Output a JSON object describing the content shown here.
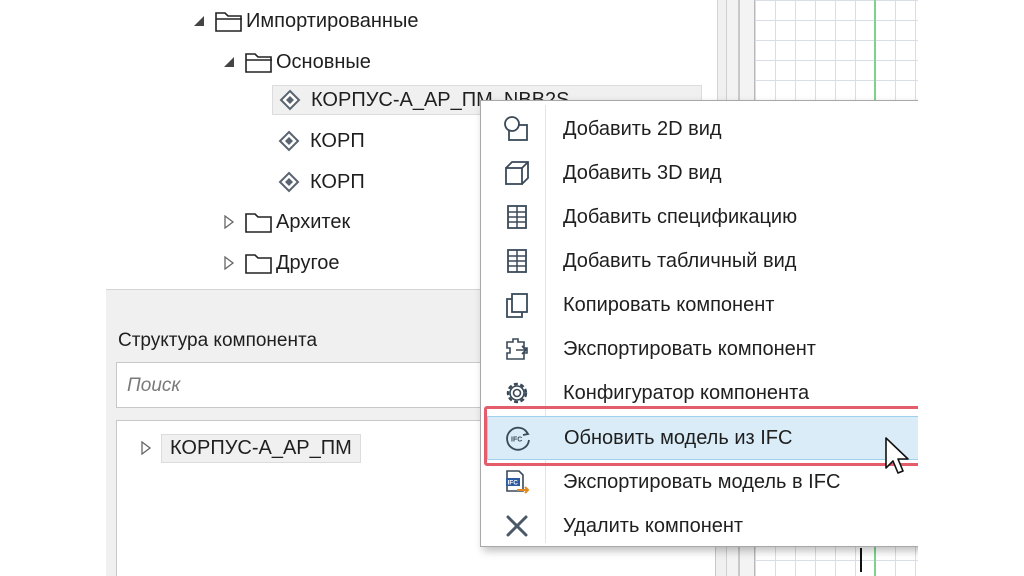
{
  "tree": {
    "imported": "Импортированные",
    "main": "Основные",
    "items": [
      "КОРПУС-А_АР_ПМ_NBB2S",
      "КОРП",
      "КОРП"
    ],
    "arch": "Архитек",
    "other": "Другое"
  },
  "structure": {
    "title": "Структура компонента",
    "search_placeholder": "Поиск",
    "root": "КОРПУС-А_АР_ПМ"
  },
  "menu": {
    "items": [
      {
        "label": "Добавить 2D вид",
        "icon": "add-2d-view-icon"
      },
      {
        "label": "Добавить 3D вид",
        "icon": "add-3d-view-icon"
      },
      {
        "label": "Добавить спецификацию",
        "icon": "specification-icon"
      },
      {
        "label": "Добавить табличный вид",
        "icon": "table-view-icon"
      },
      {
        "label": "Копировать компонент",
        "icon": "copy-icon"
      },
      {
        "label": "Экспортировать компонент",
        "icon": "export-component-icon"
      },
      {
        "label": "Конфигуратор компонента",
        "icon": "gear-icon"
      },
      {
        "label": "Обновить модель из IFC",
        "icon": "ifc-refresh-icon"
      },
      {
        "label": "Экспортировать модель в IFC",
        "icon": "ifc-export-icon"
      },
      {
        "label": "Удалить компонент",
        "icon": "delete-icon"
      }
    ],
    "highlighted_index": 7,
    "highlight_color": "#e35d6a",
    "ifc_badge": "IFC"
  }
}
